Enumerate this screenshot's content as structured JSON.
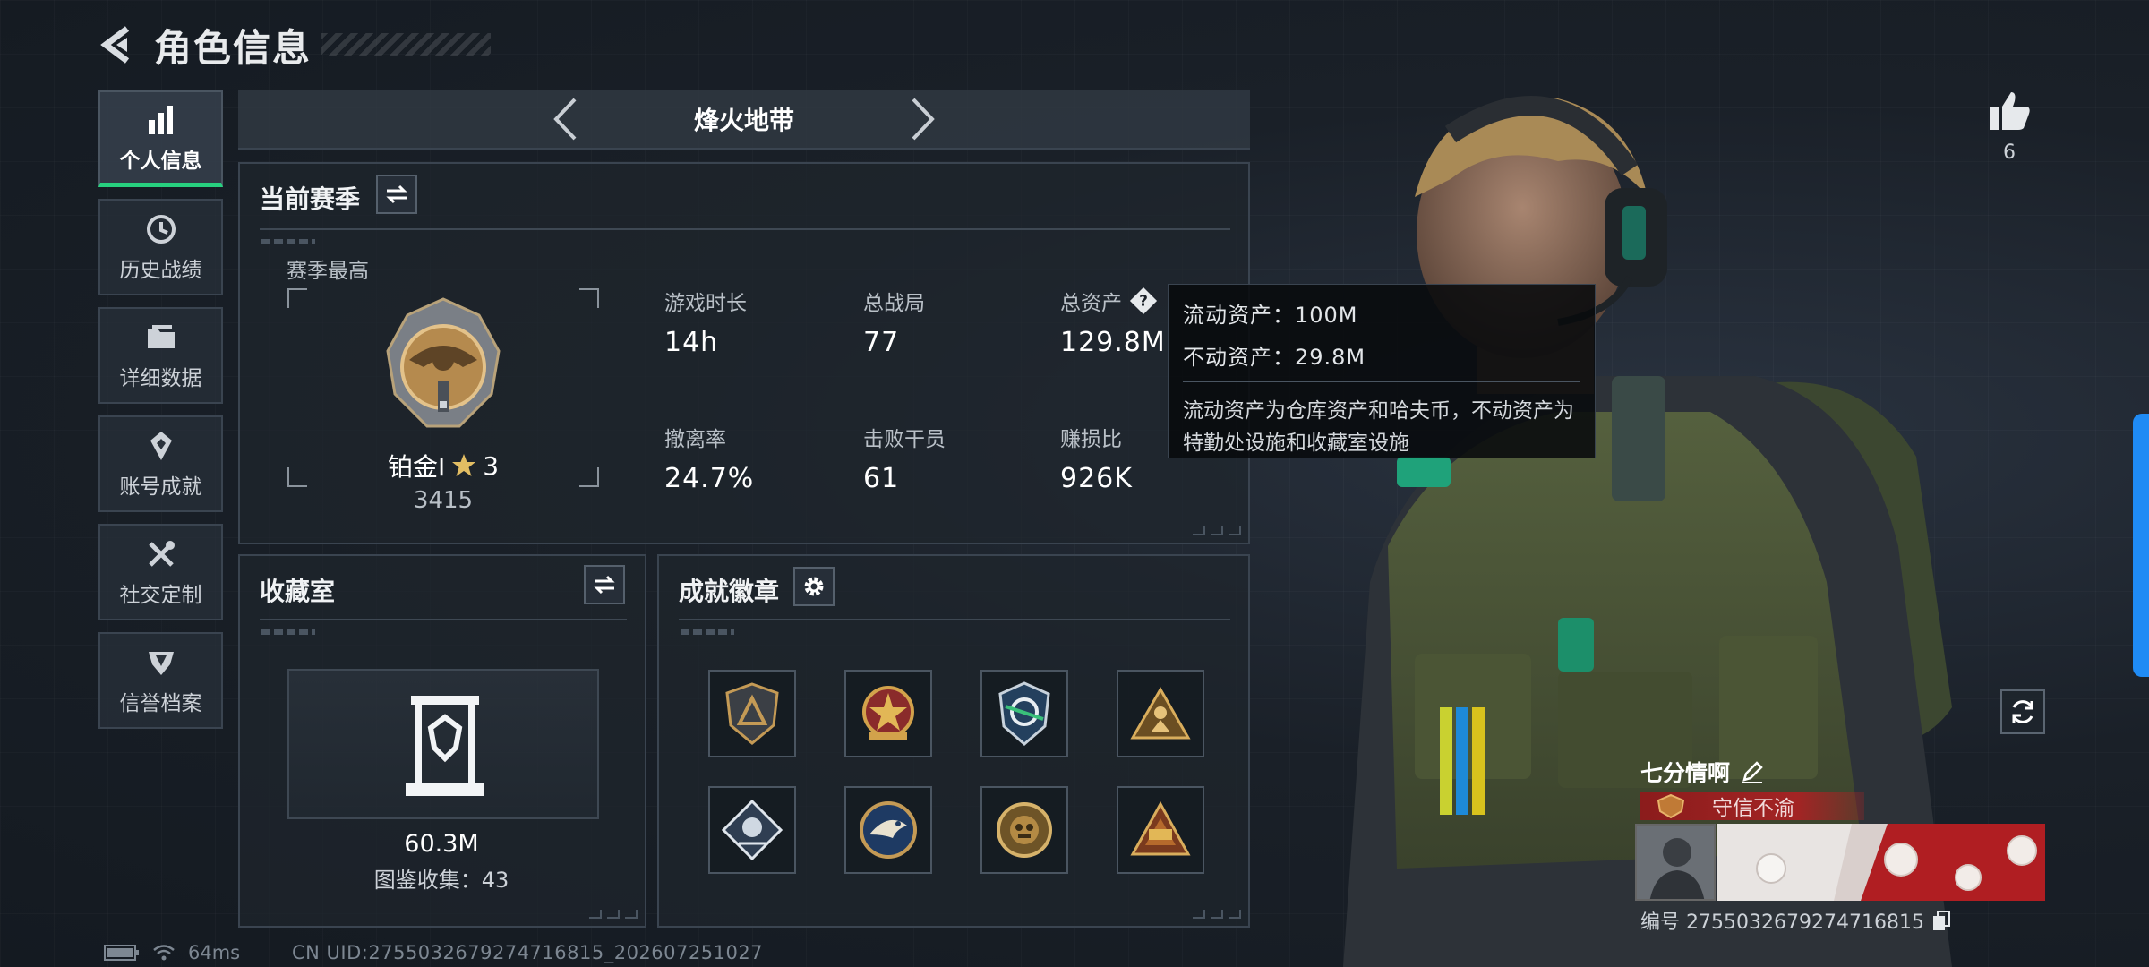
{
  "header": {
    "title": "角色信息"
  },
  "nav": [
    {
      "label": "个人信息",
      "icon": "bar-chart-icon",
      "active": true
    },
    {
      "label": "历史战绩",
      "icon": "history-clock-icon"
    },
    {
      "label": "详细数据",
      "icon": "folder-icon"
    },
    {
      "label": "账号成就",
      "icon": "achievement-icon"
    },
    {
      "label": "社交定制",
      "icon": "tools-icon"
    },
    {
      "label": "信誉档案",
      "icon": "reputation-icon"
    }
  ],
  "mode": {
    "title": "烽火地带"
  },
  "season": {
    "title": "当前赛季",
    "best_label": "赛季最高",
    "rank_name": "铂金Ⅰ",
    "rank_stars": "3",
    "rank_score": "3415",
    "stats": {
      "play_time": {
        "label": "游戏时长",
        "value": "14h"
      },
      "total_matches": {
        "label": "总战局",
        "value": "77"
      },
      "total_assets": {
        "label": "总资产",
        "value": "129.8M"
      },
      "extract_rate": {
        "label": "撤离率",
        "value": "24.7%"
      },
      "kills": {
        "label": "击败干员",
        "value": "61"
      },
      "profit_ratio": {
        "label": "赚损比",
        "value": "926K"
      }
    }
  },
  "tooltip": {
    "liquid": "流动资产：100M",
    "fixed": "不动资产：29.8M",
    "description": "流动资产为仓库资产和哈夫币，不动资产为特勤处设施和收藏室设施"
  },
  "collection": {
    "title": "收藏室",
    "value": "60.3M",
    "count_text": "图鉴收集：43"
  },
  "badges": {
    "title": "成就徽章",
    "items": [
      "triangle-shield-badge-icon",
      "star-emblem-badge-icon",
      "wing-shield-badge-icon",
      "soldier-triangle-badge-icon",
      "diamond-badge-icon",
      "eagle-badge-icon",
      "gold-emblem-badge-icon",
      "triangle-59-badge-icon"
    ]
  },
  "like": {
    "count": "6"
  },
  "profile": {
    "name": "七分情啊",
    "title": "守信不渝",
    "id_text": "编号 2755032679274716815"
  },
  "status": {
    "ping": "64ms",
    "uid": "CN UID:2755032679274716815_202607251027"
  },
  "colors": {
    "accent_green": "#27d07f",
    "edge_blue": "#1f8bf5",
    "title_red": "#a32424"
  }
}
